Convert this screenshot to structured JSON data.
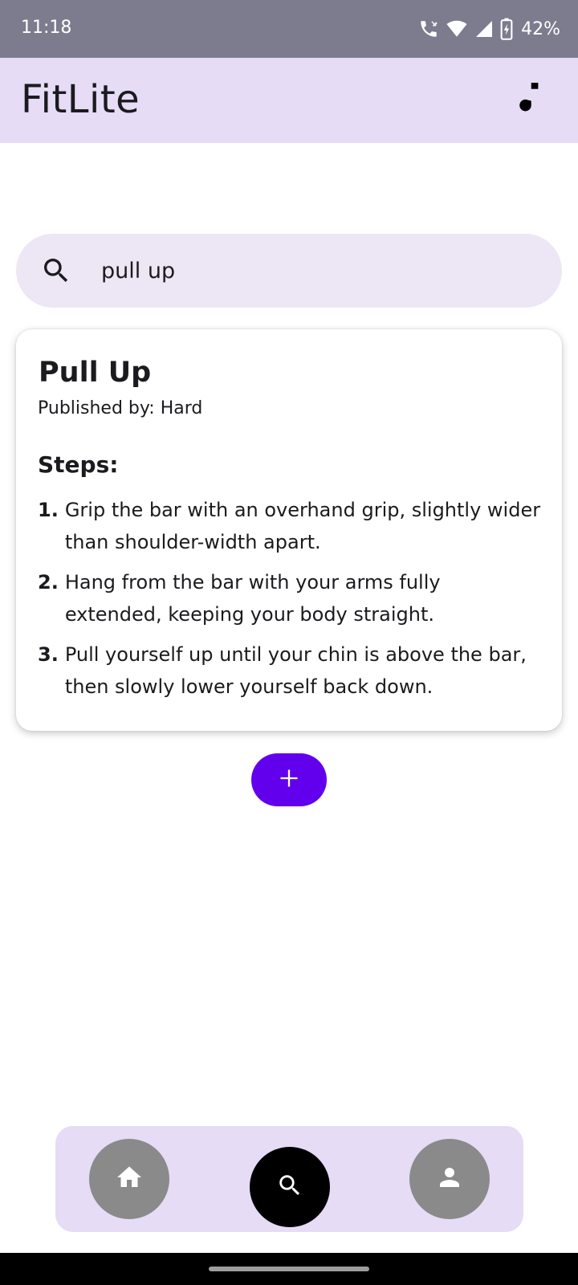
{
  "status_bar": {
    "time": "11:18",
    "battery": "42%",
    "icons": [
      "wifi-calling-icon",
      "wifi-icon",
      "signal-icon",
      "battery-charging-icon"
    ]
  },
  "app_bar": {
    "title": "FitLite",
    "action_icon": "music-note-icon"
  },
  "search": {
    "value": "pull up",
    "icon": "search-icon"
  },
  "card": {
    "title": "Pull Up",
    "publisher": "Published by: Hard",
    "steps_heading": "Steps:",
    "steps": [
      {
        "num": "1.",
        "text": "Grip the bar with an overhand grip, slightly wider than shoulder-width apart."
      },
      {
        "num": "2.",
        "text": "Hang from the bar with your arms fully extended, keeping your body straight."
      },
      {
        "num": "3.",
        "text": "Pull yourself up until your chin is above the bar, then slowly lower yourself back down."
      }
    ]
  },
  "fab": {
    "icon": "plus-icon",
    "color": "#6200ee"
  },
  "bottom_nav": {
    "items": [
      {
        "icon": "home-icon",
        "active": false
      },
      {
        "icon": "search-icon",
        "active": true
      },
      {
        "icon": "person-icon",
        "active": false
      }
    ]
  },
  "colors": {
    "status_bar": "#7d7c8e",
    "app_bar": "#e6dcf6",
    "search_bg": "#ede6f4",
    "nav_bg": "#e6dcf6",
    "nav_inactive": "#8a8a8a",
    "nav_active": "#000000"
  }
}
